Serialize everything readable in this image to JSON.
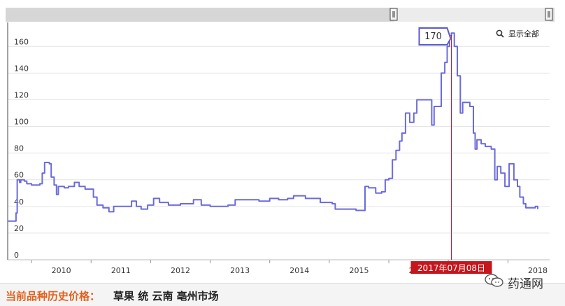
{
  "chart_data": {
    "type": "line",
    "title": "",
    "xlabel": "",
    "ylabel": "",
    "x_ticks": [
      "2010",
      "2011",
      "2012",
      "2013",
      "2014",
      "2015",
      "2016",
      "2017",
      "2018"
    ],
    "y_ticks": [
      0,
      20,
      40,
      60,
      80,
      100,
      120,
      140,
      160
    ],
    "xlim": [
      2009.6,
      2018.7
    ],
    "ylim": [
      0,
      178
    ],
    "grid": "horizontal",
    "series": [
      {
        "color": "#6b6bdb",
        "points": [
          [
            2009.6,
            29
          ],
          [
            2009.73,
            29
          ],
          [
            2009.74,
            35
          ],
          [
            2009.76,
            60
          ],
          [
            2009.8,
            58
          ],
          [
            2009.82,
            60
          ],
          [
            2009.88,
            59
          ],
          [
            2009.92,
            57
          ],
          [
            2010.0,
            56
          ],
          [
            2010.14,
            57
          ],
          [
            2010.18,
            65
          ],
          [
            2010.22,
            73
          ],
          [
            2010.3,
            72
          ],
          [
            2010.33,
            62
          ],
          [
            2010.38,
            56
          ],
          [
            2010.42,
            49
          ],
          [
            2010.45,
            55
          ],
          [
            2010.55,
            54
          ],
          [
            2010.62,
            55
          ],
          [
            2010.72,
            58
          ],
          [
            2010.8,
            55
          ],
          [
            2010.9,
            53
          ],
          [
            2011.04,
            47
          ],
          [
            2011.1,
            41
          ],
          [
            2011.2,
            39
          ],
          [
            2011.3,
            36
          ],
          [
            2011.38,
            40
          ],
          [
            2011.55,
            40
          ],
          [
            2011.68,
            44
          ],
          [
            2011.76,
            40
          ],
          [
            2011.84,
            38
          ],
          [
            2011.95,
            41
          ],
          [
            2012.05,
            46
          ],
          [
            2012.15,
            43
          ],
          [
            2012.3,
            41
          ],
          [
            2012.5,
            42
          ],
          [
            2012.72,
            45
          ],
          [
            2012.85,
            41
          ],
          [
            2013.0,
            40
          ],
          [
            2013.15,
            40
          ],
          [
            2013.3,
            41
          ],
          [
            2013.42,
            45
          ],
          [
            2013.7,
            45
          ],
          [
            2013.82,
            44
          ],
          [
            2014.0,
            46
          ],
          [
            2014.15,
            45
          ],
          [
            2014.3,
            46
          ],
          [
            2014.4,
            48
          ],
          [
            2014.6,
            46
          ],
          [
            2014.85,
            43
          ],
          [
            2015.05,
            42
          ],
          [
            2015.1,
            38
          ],
          [
            2015.35,
            38
          ],
          [
            2015.45,
            37
          ],
          [
            2015.57,
            37
          ],
          [
            2015.6,
            55
          ],
          [
            2015.66,
            54
          ],
          [
            2015.78,
            50
          ],
          [
            2015.88,
            51
          ],
          [
            2015.94,
            60
          ],
          [
            2016.0,
            61
          ],
          [
            2016.06,
            75
          ],
          [
            2016.12,
            82
          ],
          [
            2016.18,
            89
          ],
          [
            2016.22,
            95
          ],
          [
            2016.28,
            110
          ],
          [
            2016.35,
            103
          ],
          [
            2016.42,
            110
          ],
          [
            2016.47,
            120
          ],
          [
            2016.7,
            120
          ],
          [
            2016.72,
            101
          ],
          [
            2016.76,
            115
          ],
          [
            2016.82,
            115
          ],
          [
            2016.88,
            140
          ],
          [
            2016.94,
            148
          ],
          [
            2016.98,
            160
          ],
          [
            2017.02,
            168
          ],
          [
            2017.05,
            170
          ],
          [
            2017.1,
            160
          ],
          [
            2017.15,
            138
          ],
          [
            2017.2,
            110
          ],
          [
            2017.24,
            118
          ],
          [
            2017.36,
            115
          ],
          [
            2017.42,
            95
          ],
          [
            2017.45,
            83
          ],
          [
            2017.48,
            90
          ],
          [
            2017.55,
            87
          ],
          [
            2017.62,
            85
          ],
          [
            2017.72,
            83
          ],
          [
            2017.78,
            60
          ],
          [
            2017.82,
            70
          ],
          [
            2017.88,
            65
          ],
          [
            2017.95,
            55
          ],
          [
            2018.02,
            72
          ],
          [
            2018.1,
            60
          ],
          [
            2018.16,
            55
          ],
          [
            2018.2,
            47
          ],
          [
            2018.26,
            42
          ],
          [
            2018.3,
            39
          ],
          [
            2018.42,
            39
          ],
          [
            2018.46,
            40
          ],
          [
            2018.5,
            38
          ]
        ]
      }
    ],
    "tooltip_value": "170",
    "crosshair_label": "2017年07月08日",
    "crosshair_x": 2017.05,
    "zoom_reset_label": "显示全部"
  },
  "footer": {
    "label": "当前品种历史价格：",
    "title": "草果 统 云南 亳州市场"
  },
  "watermark": "药通网"
}
